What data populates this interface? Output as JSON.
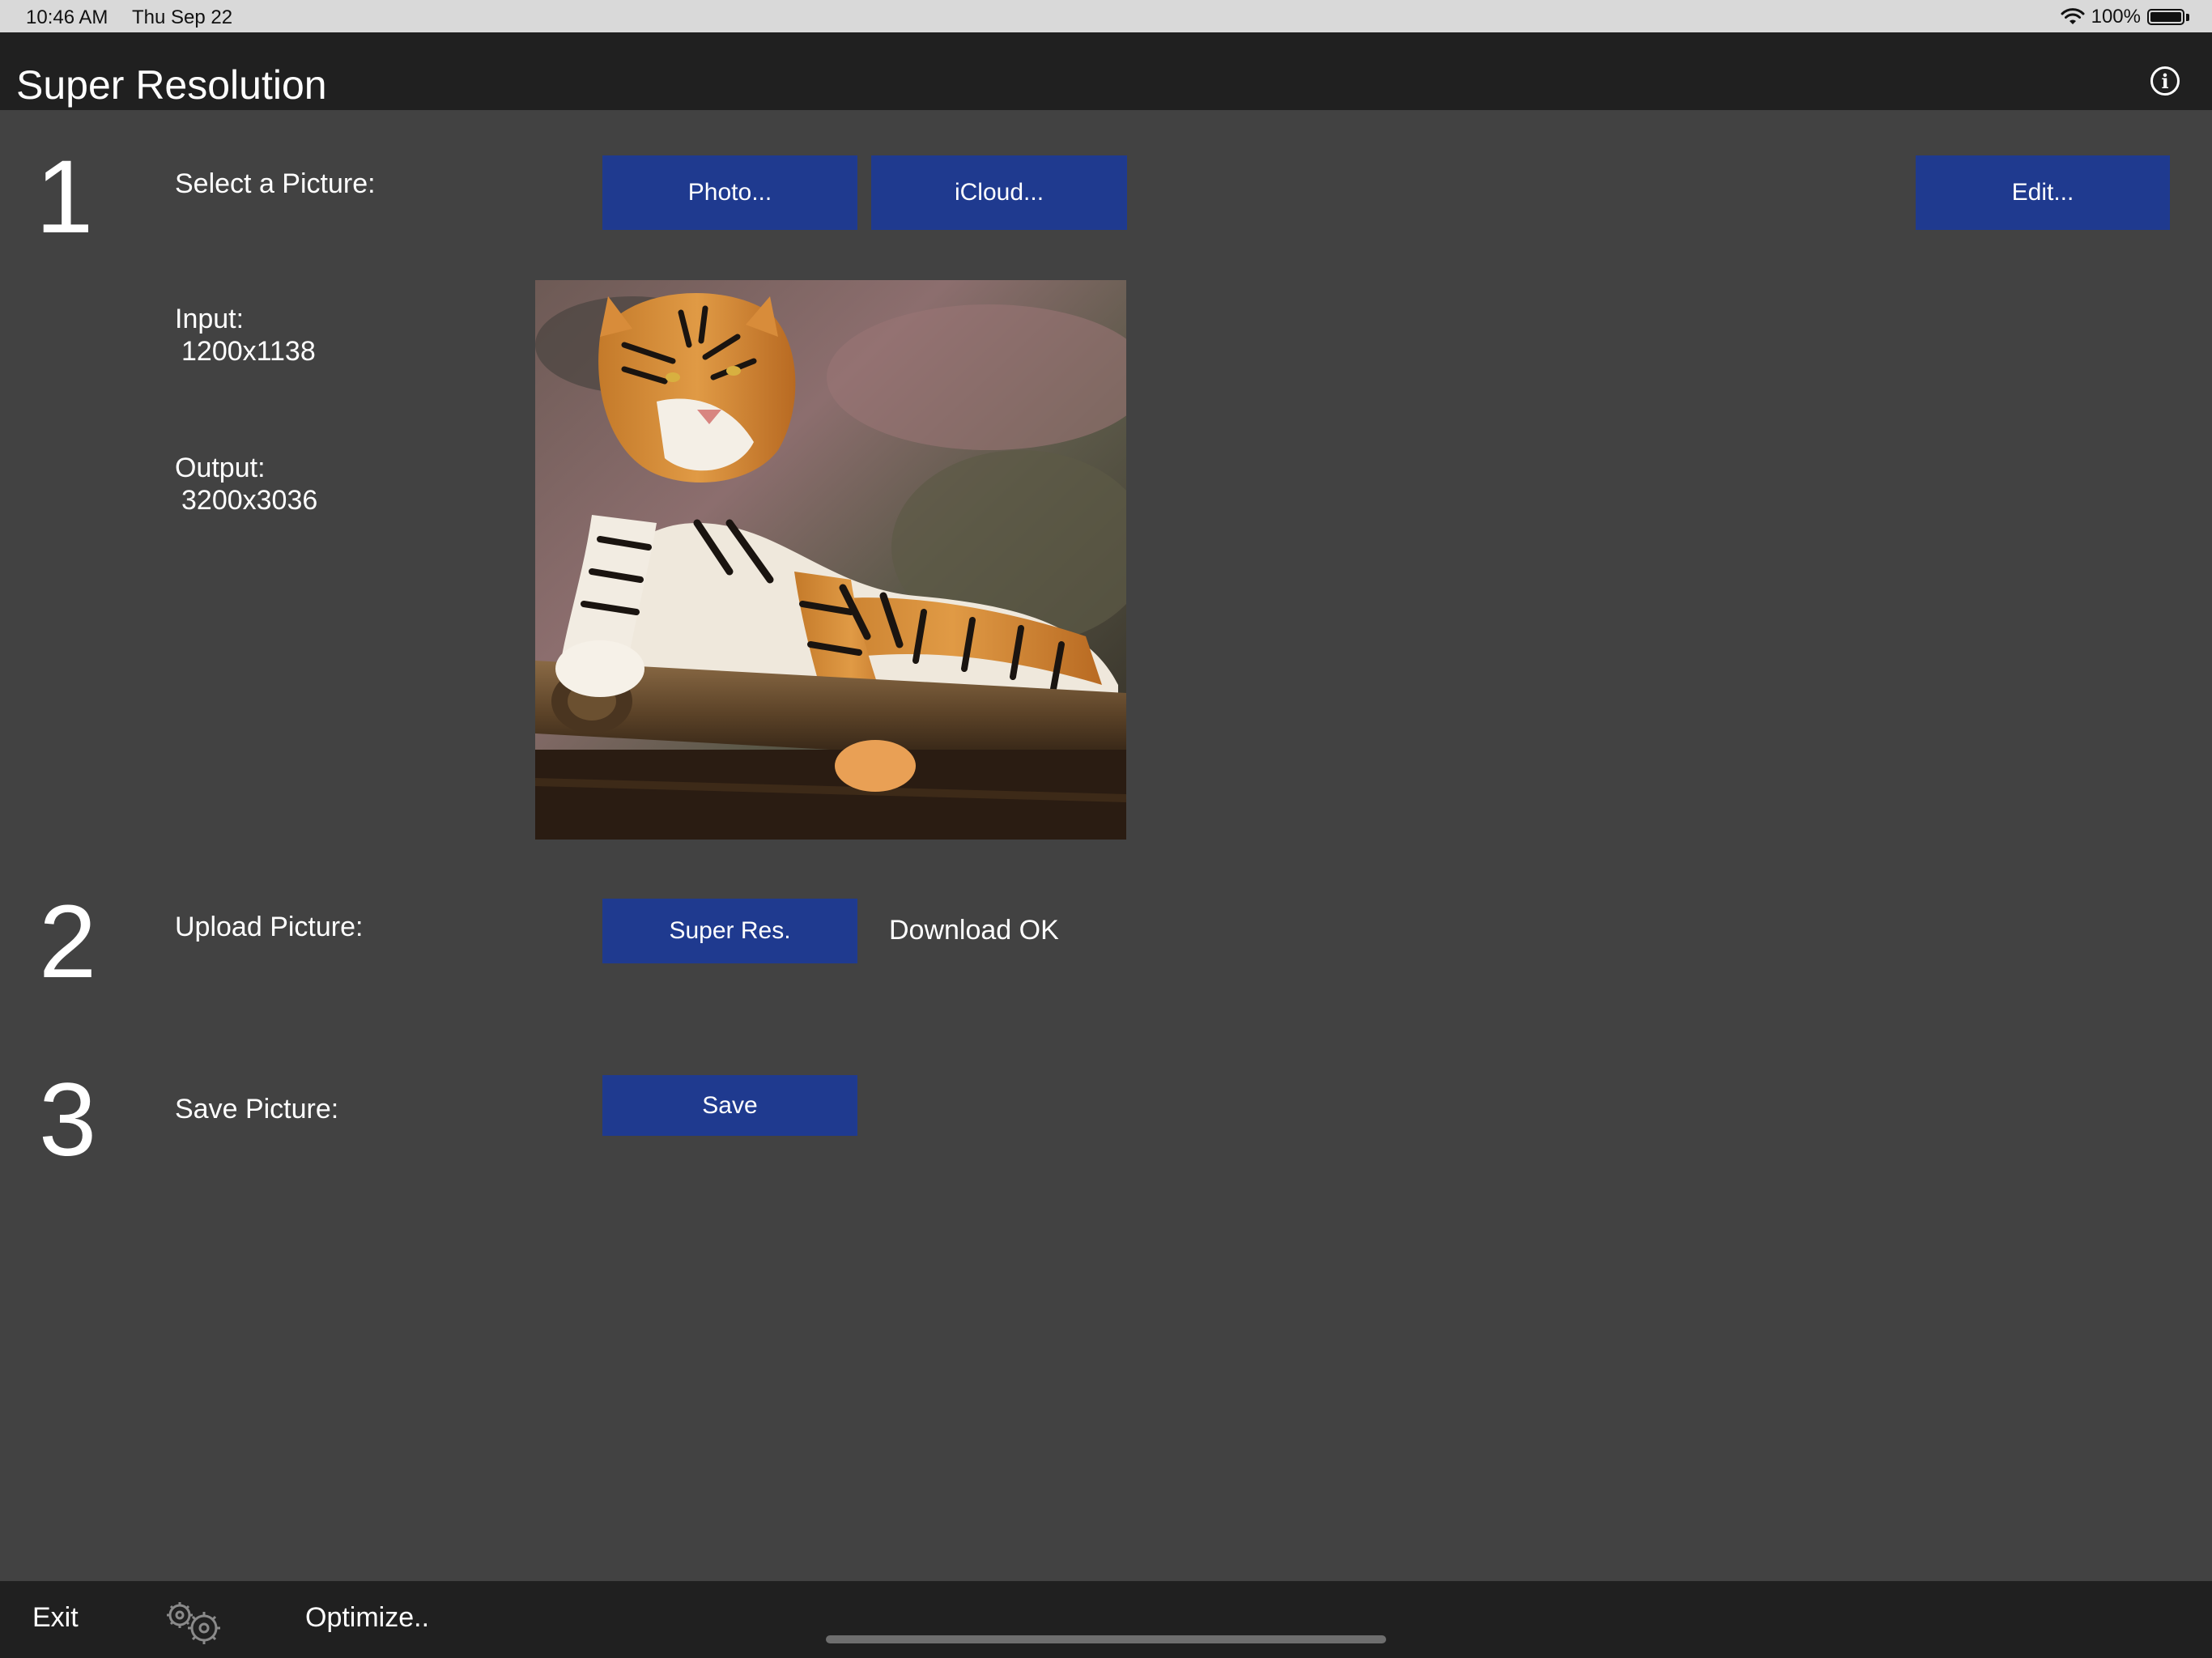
{
  "status_bar": {
    "time": "10:46 AM",
    "date": "Thu Sep 22",
    "battery": "100%",
    "icons": [
      "wifi-icon",
      "battery-icon"
    ]
  },
  "nav": {
    "title": "Super Resolution",
    "info_icon": "info-circle-icon"
  },
  "step1": {
    "number": "1",
    "label": "Select a Picture:",
    "buttons": {
      "photo": "Photo...",
      "icloud": "iCloud...",
      "edit": "Edit..."
    },
    "input_label": "Input:",
    "input_value": "1200x1138",
    "output_label": "Output:",
    "output_value": "3200x3036",
    "picture": "tiger-photo"
  },
  "step2": {
    "number": "2",
    "label": "Upload Picture:",
    "button": "Super Res.",
    "status": "Download OK"
  },
  "step3": {
    "number": "3",
    "label": "Save Picture:",
    "button": "Save"
  },
  "toolbar": {
    "exit": "Exit",
    "gears_icon": "gears-icon",
    "optimize": "Optimize.."
  },
  "colors": {
    "background": "#424242",
    "bar": "#202020",
    "button": "#1f3a8f",
    "status_bar": "#d9d9d9"
  }
}
